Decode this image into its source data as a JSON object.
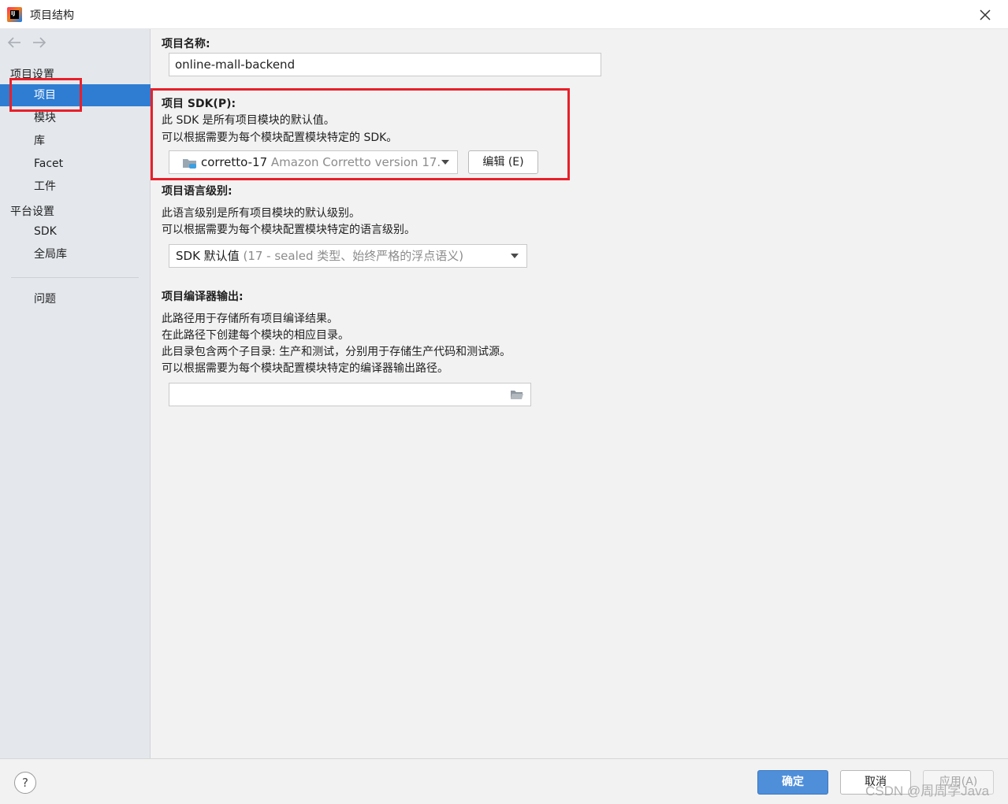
{
  "window": {
    "title": "项目结构",
    "app_icon": "intellij-idea-icon",
    "close_icon": "close-icon"
  },
  "sidebar": {
    "back_icon": "arrow-left-icon",
    "forward_icon": "arrow-right-icon",
    "group_project_settings": "项目设置",
    "items_project": [
      {
        "label": "项目",
        "selected": true
      },
      {
        "label": "模块"
      },
      {
        "label": "库"
      },
      {
        "label": "Facet"
      },
      {
        "label": "工件"
      }
    ],
    "group_platform_settings": "平台设置",
    "items_platform": [
      {
        "label": "SDK"
      },
      {
        "label": "全局库"
      }
    ],
    "problems_label": "问题",
    "selection_color": "#2e7dd2",
    "highlight_color": "#e8202a"
  },
  "main": {
    "project_name": {
      "label": "项目名称:",
      "value": "online-mall-backend"
    },
    "sdk": {
      "label": "项目 SDK(P):",
      "desc1": "此 SDK 是所有项目模块的默认值。",
      "desc2": "可以根据需要为每个模块配置模块特定的 SDK。",
      "selected_name": "corretto-17",
      "selected_detail": "Amazon Corretto version 17.",
      "edit_button": "编辑 (E)",
      "icon": "folder-sdk-icon"
    },
    "language_level": {
      "label": "项目语言级别:",
      "desc1": "此语言级别是所有项目模块的默认级别。",
      "desc2": "可以根据需要为每个模块配置模块特定的语言级别。",
      "selected_value": "SDK 默认值",
      "selected_detail": "(17 - sealed 类型、始终严格的浮点语义)"
    },
    "compiler_output": {
      "label": "项目编译器输出:",
      "desc1": "此路径用于存储所有项目编译结果。",
      "desc2": "在此路径下创建每个模块的相应目录。",
      "desc3": "此目录包含两个子目录: 生产和测试，分别用于存储生产代码和测试源。",
      "desc4": "可以根据需要为每个模块配置模块特定的编译器输出路径。",
      "value": "",
      "browse_icon": "folder-open-icon"
    }
  },
  "footer": {
    "help": "?",
    "ok": "确定",
    "cancel": "取消",
    "apply": "应用(A)",
    "watermark": "CSDN @周周学Java"
  }
}
